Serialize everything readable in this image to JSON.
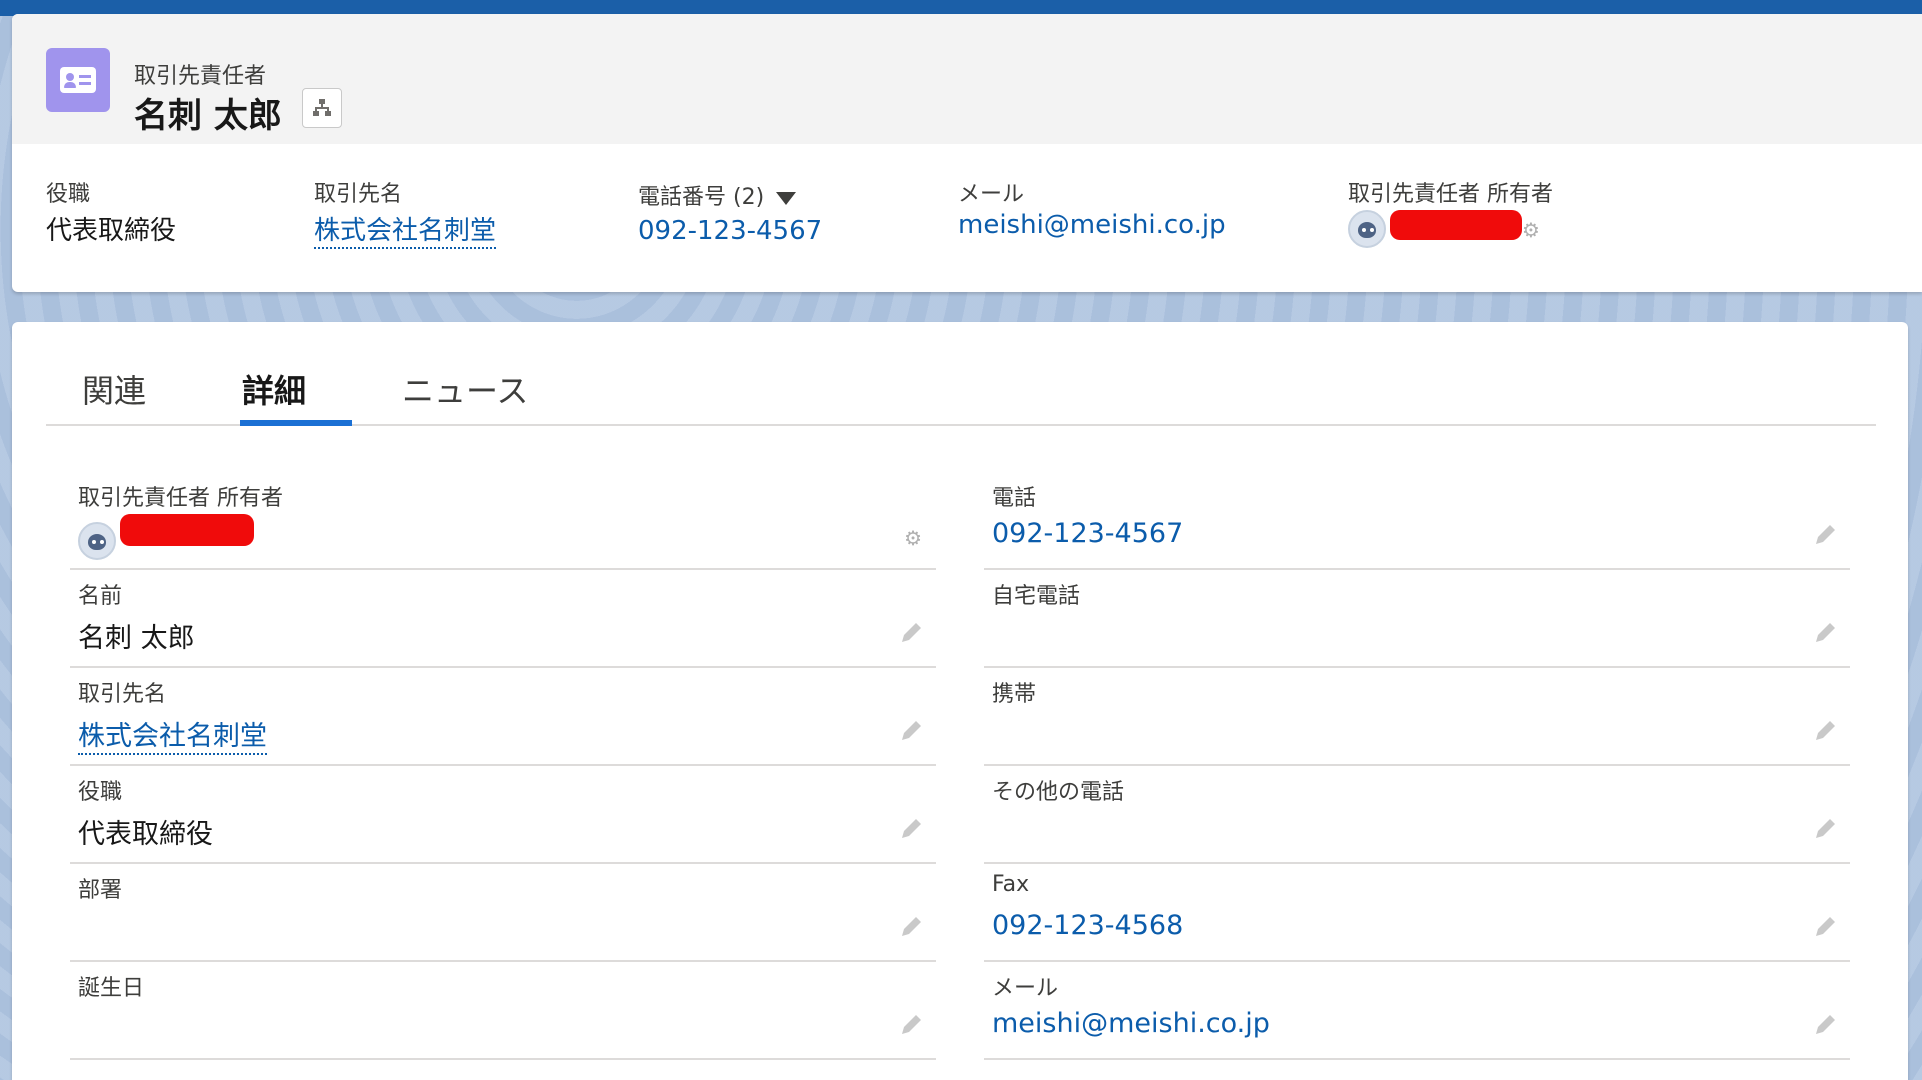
{
  "header": {
    "object_type": "取引先責任者",
    "record_name": "名刺 太郎",
    "hierarchy_icon": "hierarchy-icon",
    "record_icon": "contact-card-icon",
    "highlights": {
      "title": {
        "label": "役職",
        "value": "代表取締役"
      },
      "account": {
        "label": "取引先名",
        "value": "株式会社名刺堂"
      },
      "phone": {
        "label": "電話番号 (2)",
        "value": "092-123-4567"
      },
      "email": {
        "label": "メール",
        "value": "meishi@meishi.co.jp"
      },
      "owner": {
        "label": "取引先責任者 所有者"
      }
    }
  },
  "tabs": [
    {
      "label": "関連"
    },
    {
      "label": "詳細"
    },
    {
      "label": "ニュース"
    }
  ],
  "details": {
    "left": [
      {
        "label": "取引先責任者 所有者",
        "value": ""
      },
      {
        "label": "名前",
        "value": "名刺 太郎"
      },
      {
        "label": "取引先名",
        "value": "株式会社名刺堂"
      },
      {
        "label": "役職",
        "value": "代表取締役"
      },
      {
        "label": "部署",
        "value": ""
      },
      {
        "label": "誕生日",
        "value": ""
      }
    ],
    "right": [
      {
        "label": "電話",
        "value": "092-123-4567"
      },
      {
        "label": "自宅電話",
        "value": ""
      },
      {
        "label": "携帯",
        "value": ""
      },
      {
        "label": "その他の電話",
        "value": ""
      },
      {
        "label": "Fax",
        "value": "092-123-4568"
      },
      {
        "label": "メール",
        "value": "meishi@meishi.co.jp"
      }
    ]
  },
  "colors": {
    "link": "#0b5cab",
    "tab_active": "#1b70d4",
    "record_icon_bg": "#a094ed",
    "redaction": "#f00b0b"
  }
}
